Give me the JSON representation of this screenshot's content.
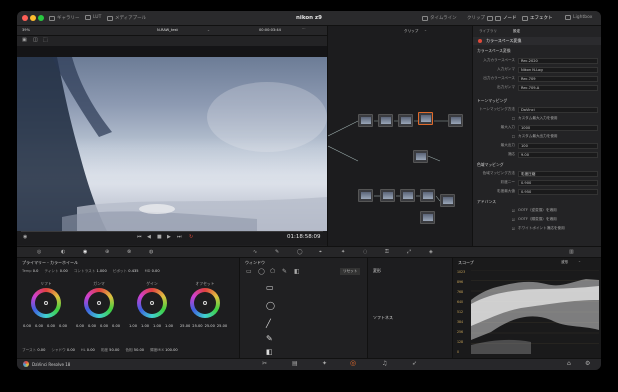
{
  "app": {
    "window_title": "nikon z9",
    "footer_name": "DaVinci Resolve 18"
  },
  "topbar": {
    "left": [
      "ギャラリー",
      "LUT",
      "メディアプール"
    ],
    "right": [
      "タイムライン",
      "クリップ",
      "ノード",
      "エフェクト",
      "Lightbox"
    ]
  },
  "viewer": {
    "zoom": "39%",
    "clip_name": "N-RAW_test",
    "timecode_top": "00:00:03:44",
    "timecode": "01:18:58:09"
  },
  "nodes_header": {
    "label": "クリップ"
  },
  "right_panel": {
    "tabs": [
      "ライブラリ",
      "設定"
    ],
    "header": "カラースペース変換",
    "section1": "カラースペース変換",
    "rows1": [
      {
        "k": "入力カラースペース",
        "v": "Rec.2020"
      },
      {
        "k": "入力ガンマ",
        "v": "Nikon N-Log"
      },
      {
        "k": "出力カラースペース",
        "v": "Rec.709"
      },
      {
        "k": "出力ガンマ",
        "v": "Rec.709-A"
      }
    ],
    "section2": "トーンマッピング",
    "rows2": [
      {
        "k": "トーンマッピング方法",
        "v": "DaVinci"
      },
      {
        "k": "",
        "v": "カスタム最大入力を使用"
      },
      {
        "k": "最大入力",
        "v": "1000"
      },
      {
        "k": "",
        "v": "カスタム最大出力を使用"
      },
      {
        "k": "最大出力",
        "v": "100"
      },
      {
        "k": "適応",
        "v": "9.00"
      }
    ],
    "section3": "色域マッピング",
    "rows3": [
      {
        "k": "色域マッピング方法",
        "v": "彩度圧縮"
      },
      {
        "k": "彩度ニー",
        "v": "0.900"
      },
      {
        "k": "彩度最大値",
        "v": "0.950"
      }
    ],
    "section4": "アドバンス",
    "checks": [
      "OOTF（逆変換）を適用",
      "OOTF（順変換）を適用",
      "ホワイトポイント適応を使用"
    ]
  },
  "wheels": {
    "title": "プライマリー - カラーホイール",
    "params_top": [
      {
        "k": "Temp",
        "v": "0.0"
      },
      {
        "k": "ティント",
        "v": "0.00"
      },
      {
        "k": "コントラスト",
        "v": "1.000"
      },
      {
        "k": "ピボット",
        "v": "0.435"
      },
      {
        "k": "MD",
        "v": "0.00"
      }
    ],
    "names": [
      "リフト",
      "ガンマ",
      "ゲイン",
      "オフセット"
    ],
    "values": [
      [
        "0.00",
        "0.00",
        "0.00",
        "0.00"
      ],
      [
        "0.00",
        "0.00",
        "0.00",
        "0.00"
      ],
      [
        "1.00",
        "1.00",
        "1.00",
        "1.00"
      ],
      [
        "25.00",
        "25.00",
        "25.00",
        "25.00"
      ]
    ],
    "params_bottom": [
      {
        "k": "ブースト",
        "v": "0.00"
      },
      {
        "k": "シャドウ",
        "v": "0.00"
      },
      {
        "k": "HL",
        "v": "0.00"
      },
      {
        "k": "彩度",
        "v": "50.00"
      },
      {
        "k": "色相",
        "v": "50.00"
      },
      {
        "k": "輝度MIX",
        "v": "100.00"
      }
    ]
  },
  "window_panel": {
    "title": "ウィンドウ",
    "button": "リセット"
  },
  "transform": {
    "title": "変形",
    "sub": "ソフトネス"
  },
  "scope": {
    "title": "スコープ",
    "mode": "波形",
    "ticks": [
      "1023",
      "896",
      "768",
      "640",
      "512",
      "384",
      "256",
      "128",
      "0"
    ]
  }
}
